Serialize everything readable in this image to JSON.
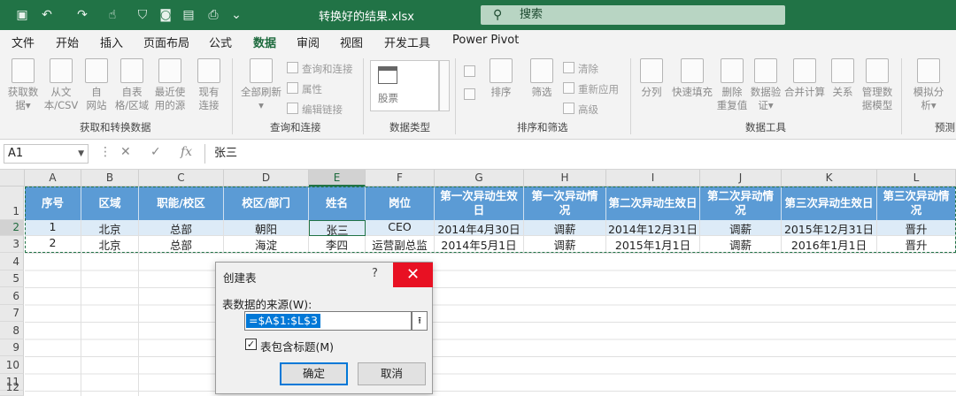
{
  "window": {
    "title": "转换好的结果.xlsx",
    "search_placeholder": "搜索"
  },
  "menu": [
    "文件",
    "开始",
    "插入",
    "页面布局",
    "公式",
    "数据",
    "审阅",
    "视图",
    "开发工具",
    "Power Pivot"
  ],
  "ribbon": {
    "groups": {
      "get": "获取和转换数据",
      "query": "查询和连接",
      "types": "数据类型",
      "sort": "排序和筛选",
      "tools": "数据工具",
      "forecast": "预测"
    },
    "buttons": {
      "get_data": "获取数\n据▾",
      "from_text": "从文\n本/CSV",
      "from_web": "自\n网站",
      "from_table": "自表\n格/区域",
      "recent": "最近使\n用的源",
      "existing": "现有\n连接",
      "refresh_all": "全部刷新\n▾",
      "sort": "排序",
      "filter": "筛选",
      "split": "分列",
      "flash_fill": "快速填充",
      "remove_dup": "删除\n重复值",
      "validation": "数据验\n证▾",
      "consolidate": "合并计算",
      "relations": "关系",
      "manage_model": "管理数\n据模型",
      "whatif": "模拟分\n析▾"
    },
    "small": {
      "query_conn": "查询和连接",
      "props": "属性",
      "edit_links": "编辑链接",
      "clear": "清除",
      "reapply": "重新应用",
      "advanced": "高级"
    },
    "stock": "股票"
  },
  "formula_bar": {
    "name_box": "A1",
    "fx": "fx",
    "content": "张三"
  },
  "sheet": {
    "columns": [
      "A",
      "B",
      "C",
      "D",
      "E",
      "F",
      "G",
      "H",
      "I",
      "J",
      "K",
      "L"
    ],
    "row_numbers": [
      "1",
      "2",
      "3",
      "4",
      "5",
      "6",
      "7",
      "8",
      "9",
      "10",
      "11",
      "12"
    ],
    "header": [
      "序号",
      "区域",
      "职能/校区",
      "校区/部门",
      "姓名",
      "岗位",
      "第一次异动生效日",
      "第一次异动情况",
      "第二次异动生效日",
      "第二次异动情况",
      "第三次异动生效日",
      "第三次异动情况"
    ],
    "rows": [
      [
        "1",
        "北京",
        "总部",
        "朝阳",
        "张三",
        "CEO",
        "2014年4月30日",
        "调薪",
        "2014年12月31日",
        "调薪",
        "2015年12月31日",
        "晋升"
      ],
      [
        "2",
        "北京",
        "总部",
        "海淀",
        "李四",
        "运营副总监",
        "2014年5月1日",
        "调薪",
        "2015年1月1日",
        "调薪",
        "2016年1月1日",
        "晋升"
      ]
    ]
  },
  "dialog": {
    "title": "创建表",
    "help": "?",
    "close": "✕",
    "source_label": "表数据的来源(W):",
    "range": "=$A$1:$L$3",
    "collapse": "⭱",
    "has_headers": "表包含标题(M)",
    "checked": "✓",
    "ok": "确定",
    "cancel": "取消"
  }
}
